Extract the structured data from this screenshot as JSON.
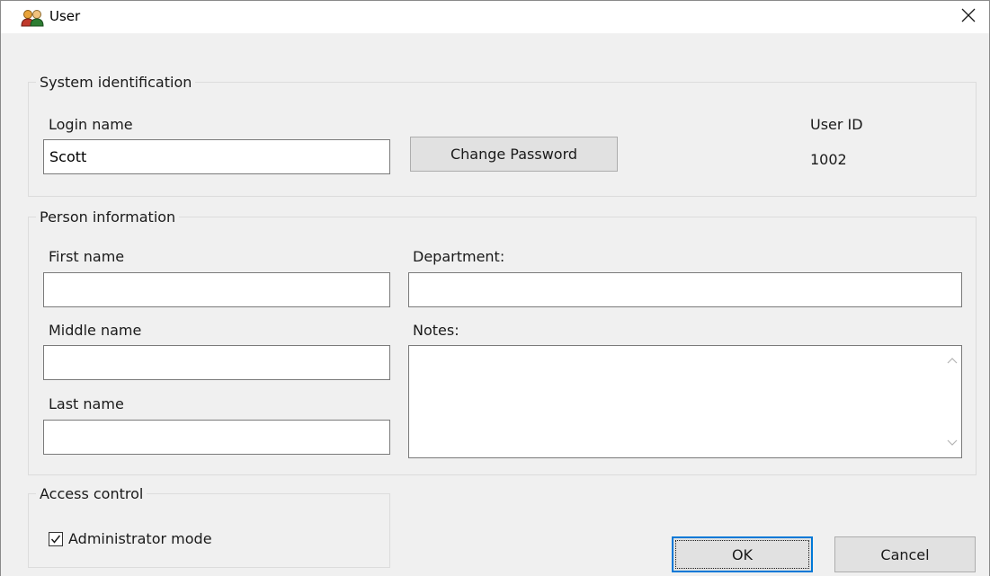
{
  "window": {
    "title": "User",
    "close_icon": "close-icon",
    "app_icon": "users-icon"
  },
  "system_identification": {
    "legend": "System identification",
    "login_name_label": "Login name",
    "login_name_value": "Scott",
    "change_password_label": "Change Password",
    "user_id_label": "User ID",
    "user_id_value": "1002"
  },
  "person_information": {
    "legend": "Person information",
    "first_name_label": "First name",
    "first_name_value": "",
    "middle_name_label": "Middle name",
    "middle_name_value": "",
    "last_name_label": "Last name",
    "last_name_value": "",
    "department_label": "Department:",
    "department_value": "",
    "notes_label": "Notes:",
    "notes_value": ""
  },
  "access_control": {
    "legend": "Access control",
    "administrator_mode_label": "Administrator mode",
    "administrator_mode_checked": true
  },
  "buttons": {
    "ok_label": "OK",
    "cancel_label": "Cancel"
  },
  "colors": {
    "dialog_background": "#f0f0f0",
    "accent_focus": "#0078d7",
    "button_face": "#e1e1e1"
  }
}
